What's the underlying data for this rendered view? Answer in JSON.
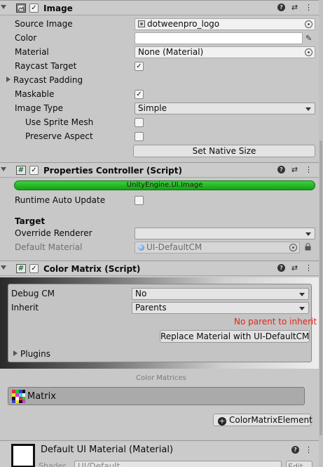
{
  "image_component": {
    "title": "Image",
    "source_image": {
      "label": "Source Image",
      "value": "dotweenpro_logo"
    },
    "color": {
      "label": "Color"
    },
    "material": {
      "label": "Material",
      "value": "None (Material)"
    },
    "raycast_target": {
      "label": "Raycast Target",
      "checked": true
    },
    "raycast_padding": {
      "label": "Raycast Padding"
    },
    "maskable": {
      "label": "Maskable",
      "checked": true
    },
    "image_type": {
      "label": "Image Type",
      "value": "Simple"
    },
    "use_sprite_mesh": {
      "label": "Use Sprite Mesh",
      "checked": false
    },
    "preserve_aspect": {
      "label": "Preserve Aspect",
      "checked": false
    },
    "set_native_size": "Set Native Size"
  },
  "properties_controller": {
    "title": "Properties Controller (Script)",
    "status_bar": "UnityEngine.UI.Image",
    "runtime_auto_update": {
      "label": "Runtime Auto Update",
      "checked": false
    },
    "target_heading": "Target",
    "override_renderer": {
      "label": "Override Renderer",
      "value": ""
    },
    "default_material": {
      "label": "Default Material",
      "value": "UI-DefaultCM"
    }
  },
  "color_matrix": {
    "title": "Color Matrix (Script)",
    "debug_cm": {
      "label": "Debug CM",
      "value": "No"
    },
    "inherit": {
      "label": "Inherit",
      "value": "Parents"
    },
    "warning": "No parent to inherit",
    "replace_button": "Replace Material with UI-DefaultCM",
    "plugins": "Plugins",
    "matrices_heading": "Color Matrices",
    "matrix_item": "Matrix",
    "add_element_button": "ColorMatrixElement"
  },
  "default_material_component": {
    "title": "Default UI Material (Material)",
    "shader_label": "Shader",
    "shader_value": "UI/Default",
    "edit_button": "Edit..."
  },
  "colors": {
    "warning": "#e0261a",
    "status_green": "#2cc02c"
  }
}
